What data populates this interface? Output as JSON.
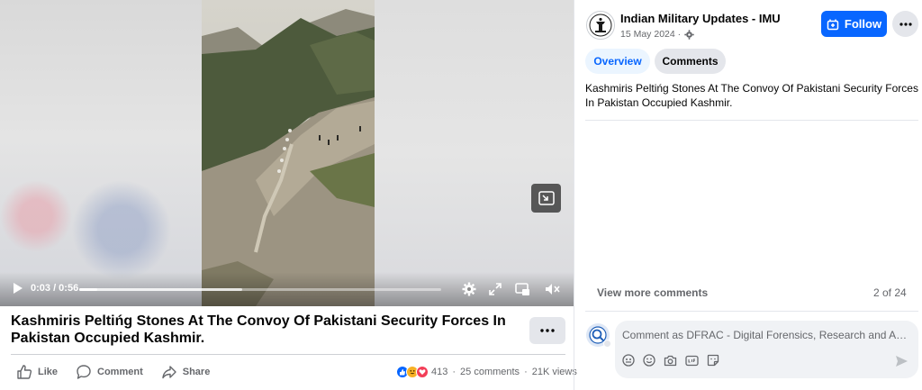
{
  "video": {
    "time": "0:03 / 0:56",
    "progress": 0.05,
    "buffered": 0.45
  },
  "post": {
    "title": "Kashmiris Peltińg Stones At The Convoy Of Pakistani Security Forces In Pakistan Occupied Kashmir.",
    "actions": {
      "like": "Like",
      "comment": "Comment",
      "share": "Share"
    },
    "reaction_count": "413",
    "comments_count": "25 comments",
    "views_count": "21K views",
    "separator": "·"
  },
  "page": {
    "name": "Indian Military Updates - IMU",
    "date": "15 May 2024 ·",
    "follow_label": "Follow"
  },
  "tabs": {
    "overview": "Overview",
    "comments": "Comments"
  },
  "caption": "Kashmiris Peltińg Stones At The Convoy Of Pakistani Security Forces In Pakistan Occupied Kashmir.",
  "comments_panel": {
    "view_more": "View more comments",
    "page_count": "2 of 24",
    "input_placeholder": "Comment as DFRAC - Digital Forensics, Research and Analytics Centre"
  },
  "colors": {
    "accent": "#0866ff",
    "secondary_text": "#65676b"
  }
}
